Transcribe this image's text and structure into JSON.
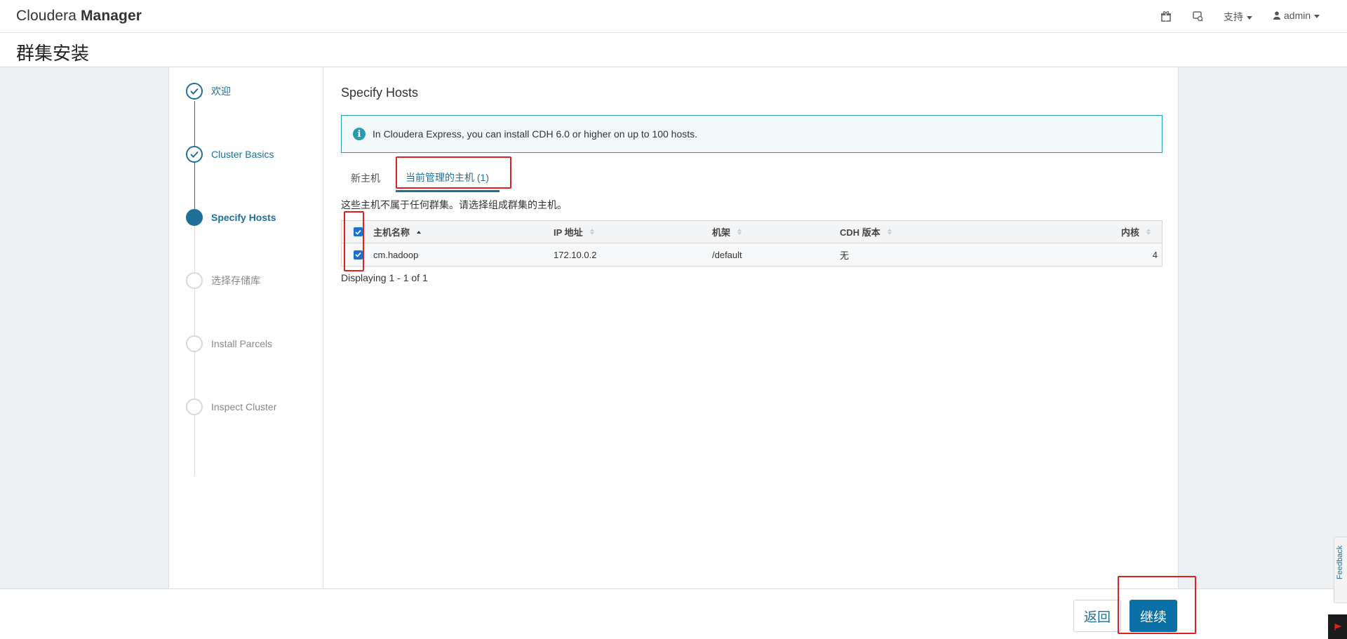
{
  "header": {
    "brand_light": "Cloudera ",
    "brand_bold": "Manager",
    "support_label": "支持",
    "user_label": "admin"
  },
  "page": {
    "title": "群集安装"
  },
  "wizard": {
    "steps": [
      {
        "label": "欢迎",
        "status": "done"
      },
      {
        "label": "Cluster Basics",
        "status": "done"
      },
      {
        "label": "Specify Hosts",
        "status": "active"
      },
      {
        "label": "选择存储库",
        "status": "pending"
      },
      {
        "label": "Install Parcels",
        "status": "pending"
      },
      {
        "label": "Inspect Cluster",
        "status": "pending"
      }
    ]
  },
  "main": {
    "section_title": "Specify Hosts",
    "info_text": "In Cloudera Express, you can install CDH 6.0 or higher on up to 100 hosts.",
    "tabs": [
      {
        "label": "新主机",
        "active": false
      },
      {
        "label": "当前管理的主机 (1)",
        "active": true
      }
    ],
    "note": "这些主机不属于任何群集。请选择组成群集的主机。",
    "table": {
      "headers": [
        "主机名称",
        "IP 地址",
        "机架",
        "CDH 版本",
        "内核"
      ],
      "sorted_column": "主机名称",
      "rows": [
        {
          "selected": true,
          "hostname": "cm.hadoop",
          "ip": "172.10.0.2",
          "rack": "/default",
          "cdh_version": "无",
          "cores": "4"
        }
      ]
    },
    "pager": "Displaying 1 - 1 of 1"
  },
  "footer": {
    "back_label": "返回",
    "continue_label": "继续"
  },
  "feedback_label": "Feedback",
  "colors": {
    "accent": "#1f6f9a",
    "primary_button": "#0a6ea7",
    "info_border": "#2a9bb6",
    "highlight_annotation": "#e0201f",
    "page_background": "#edf0f2"
  }
}
